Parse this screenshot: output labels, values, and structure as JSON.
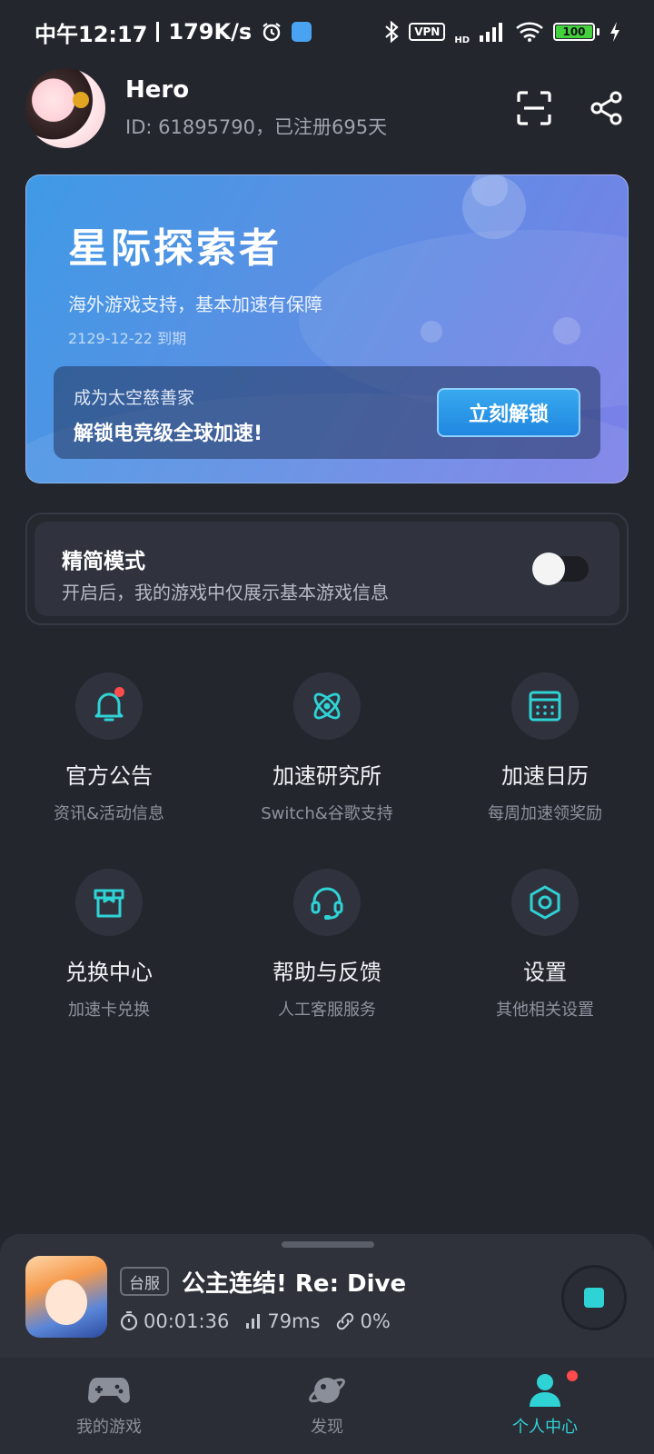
{
  "status_bar": {
    "time": "中午12:17",
    "net_speed": "179K/s",
    "vpn": "VPN",
    "hd": "HD",
    "battery": "100"
  },
  "profile": {
    "username": "Hero",
    "id_text": "ID: 61895790，已注册695天"
  },
  "vip_card": {
    "title": "星际探索者",
    "description": "海外游戏支持，基本加速有保障",
    "expire": "2129-12-22 到期",
    "promo_small": "成为太空慈善家",
    "promo_big": "解锁电竞级全球加速!",
    "unlock_label": "立刻解锁"
  },
  "simple_mode": {
    "title": "精简模式",
    "description": "开启后，我的游戏中仅展示基本游戏信息",
    "enabled": false
  },
  "features": [
    {
      "title": "官方公告",
      "subtitle": "资讯&活动信息",
      "icon": "bell-icon"
    },
    {
      "title": "加速研究所",
      "subtitle": "Switch&谷歌支持",
      "icon": "atom-icon"
    },
    {
      "title": "加速日历",
      "subtitle": "每周加速领奖励",
      "icon": "calendar-icon"
    },
    {
      "title": "兑换中心",
      "subtitle": "加速卡兑换",
      "icon": "gift-box-icon"
    },
    {
      "title": "帮助与反馈",
      "subtitle": "人工客服服务",
      "icon": "headset-icon"
    },
    {
      "title": "设置",
      "subtitle": "其他相关设置",
      "icon": "settings-hex-icon"
    }
  ],
  "now_playing": {
    "server": "台服",
    "game_title": "公主连结! Re: Dive",
    "duration": "00:01:36",
    "latency": "79ms",
    "loss": "0%"
  },
  "bottom_nav": [
    {
      "label": "我的游戏",
      "icon": "gamepad-icon",
      "active": false
    },
    {
      "label": "发现",
      "icon": "planet-icon",
      "active": false
    },
    {
      "label": "个人中心",
      "icon": "person-icon",
      "active": true
    }
  ],
  "colors": {
    "background": "#24262e",
    "accent": "#2fd3d6",
    "badge_red": "#ff4b4b"
  }
}
